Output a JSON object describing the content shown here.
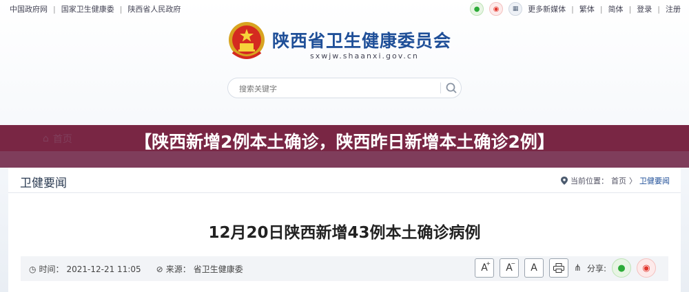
{
  "topbar": {
    "links": [
      "中国政府网",
      "国家卫生健康委",
      "陕西省人民政府"
    ],
    "right_links": [
      "更多新媒体",
      "繁体",
      "简体",
      "登录",
      "注册"
    ]
  },
  "header": {
    "title": "陕西省卫生健康委员会",
    "domain": "sxwjw.shaanxi.gov.cn",
    "search_placeholder": "搜索关键字"
  },
  "nav": {
    "home": "首页",
    "items": [
      "",
      ""
    ]
  },
  "banner": {
    "text": "【陕西新增2例本土确诊，陕西昨日新增本土确诊2例】"
  },
  "section": {
    "title": "卫健要闻",
    "breadcrumb_prefix": "当前位置：",
    "breadcrumb_home": "首页",
    "breadcrumb_sep": "〉",
    "breadcrumb_current": "卫健要闻"
  },
  "article": {
    "title": "12月20日陕西新增43例本土确诊病例",
    "time_label": "时间：",
    "time": "2021-12-21 11:05",
    "source_label": "来源：",
    "source": "省卫生健康委",
    "font_buttons": [
      "A",
      "A",
      "A"
    ],
    "share_label": "分享:"
  },
  "colors": {
    "brand_blue": "#1f4f98",
    "nav_red": "#c33b45",
    "banner": "#6e2344"
  }
}
